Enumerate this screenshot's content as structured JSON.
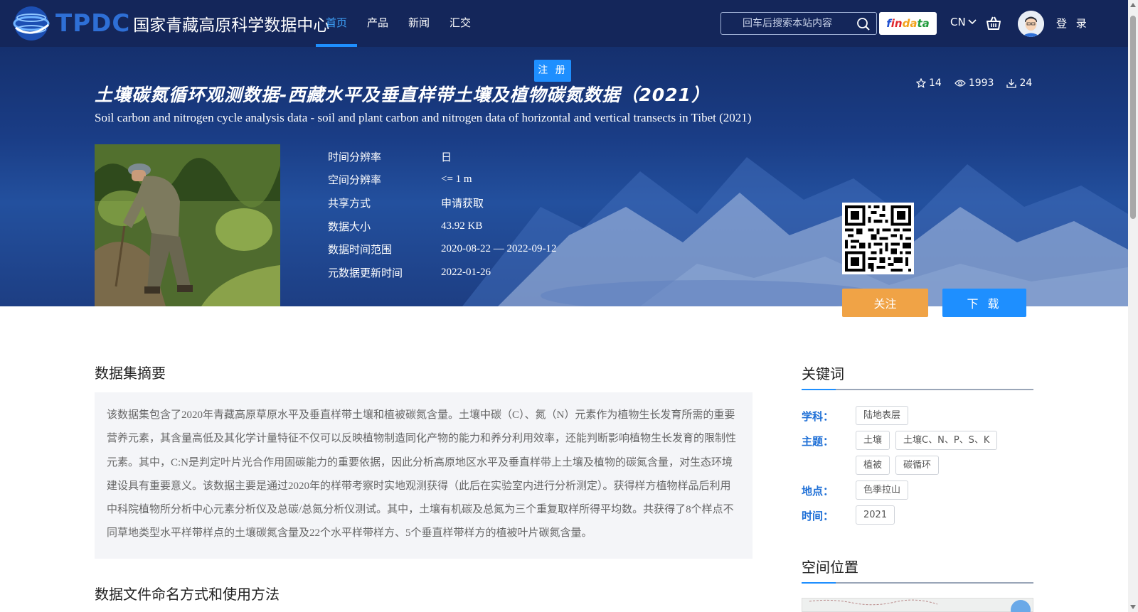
{
  "brand": {
    "logo_en": "TPDC",
    "logo_cn": "国家青藏高原科学数据中心"
  },
  "nav": {
    "items": [
      "首页",
      "产品",
      "新闻",
      "汇交"
    ],
    "active": "首页"
  },
  "search": {
    "placeholder": "回车后搜索本站内容"
  },
  "findata": {
    "p1": "f",
    "p2": "in",
    "p3": "da",
    "p4": "ta"
  },
  "lang": "CN",
  "login": "登 录",
  "register": "注 册",
  "dataset": {
    "title_cn": "土壤碳氮循环观测数据-西藏水平及垂直样带土壤及植物碳氮数据（2021）",
    "title_en": "Soil carbon and nitrogen cycle analysis data - soil and plant carbon and nitrogen data of horizontal and vertical transects in Tibet (2021)",
    "stats": {
      "stars": "14",
      "views": "1993",
      "downloads": "24"
    },
    "meta": [
      {
        "label": "时间分辨率",
        "value": "日"
      },
      {
        "label": "空间分辨率",
        "value": "<= 1 m"
      },
      {
        "label": "共享方式",
        "value": "申请获取"
      },
      {
        "label": "数据大小",
        "value": "43.92 KB"
      },
      {
        "label": "数据时间范围",
        "value": "2020-08-22 — 2022-09-12"
      },
      {
        "label": "元数据更新时间",
        "value": "2022-01-26"
      }
    ],
    "buttons": {
      "follow": "关注",
      "download": "下 载"
    }
  },
  "summary": {
    "heading": "数据集摘要",
    "text": "该数据集包含了2020年青藏高原草原水平及垂直样带土壤和植被碳氮含量。土壤中碳（C）、氮（N）元素作为植物生长发育所需的重要营养元素，其含量高低及其化学计量特征不仅可以反映植物制造同化产物的能力和养分利用效率，还能判断影响植物生长发育的限制性元素。其中，C:N是判定叶片光合作用固碳能力的重要依据，因此分析高原地区水平及垂直样带上土壤及植物的碳氮含量，对生态环境建设具有重要意义。该数据主要是通过2020年的样带考察时实地观测获得（此后在实验室内进行分析测定）。获得样方植物样品后利用中科院植物所分析中心元素分析仪及总碳/总氮分析仪测试。其中，土壤有机碳及总氮为三个重复取样所得平均数。共获得了8个样点不同草地类型水平样带样点的土壤碳氮含量及22个水平样带样方、5个垂直样带样方的植被叶片碳氮含量。"
  },
  "file_naming": {
    "heading": "数据文件命名方式和使用方法"
  },
  "keywords": {
    "heading": "关键词",
    "groups": [
      {
        "label": "学科：",
        "tags": [
          "陆地表层"
        ]
      },
      {
        "label": "主题：",
        "tags": [
          "土壤",
          "土壤C、N、P、S、K",
          "植被",
          "碳循环"
        ]
      },
      {
        "label": "地点：",
        "tags": [
          "色季拉山"
        ]
      },
      {
        "label": "时间：",
        "tags": [
          "2021"
        ]
      }
    ]
  },
  "location": {
    "heading": "空间位置"
  },
  "colors": {
    "accent": "#1e8fff",
    "follow": "#f0a346",
    "header": "#14265a",
    "keyword_label": "#1e6fd6"
  }
}
